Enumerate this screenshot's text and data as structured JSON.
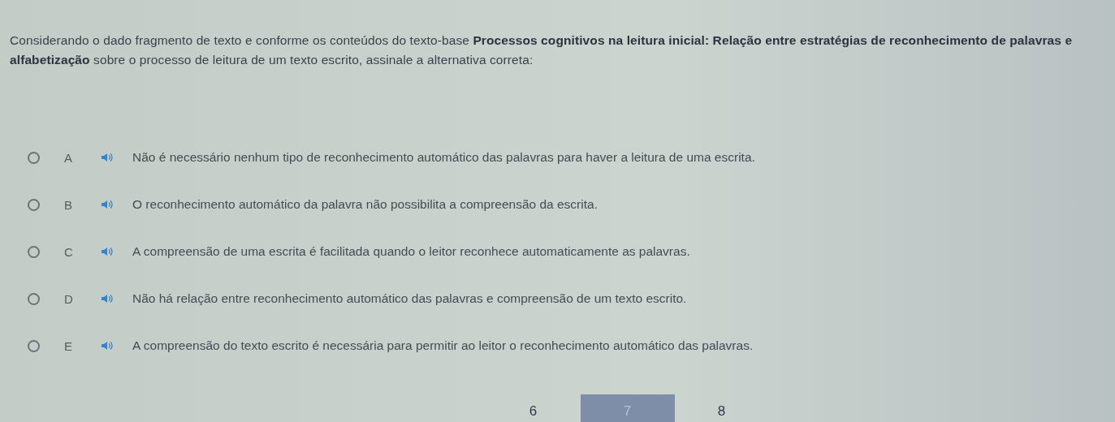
{
  "question": "Considerando o dado fragmento de texto e conforme os conteúdos do texto-base **Processos cognitivos na leitura inicial: Relação entre estratégias de reconhecimento de palavras e alfabetização** sobre o processo de leitura de um texto escrito, assinale a alternativa correta:",
  "options": [
    {
      "letter": "A",
      "text": "Não é necessário nenhum tipo de reconhecimento automático das palavras para haver a leitura de uma escrita.",
      "selected": false
    },
    {
      "letter": "B",
      "text": "O reconhecimento automático da palavra não possibilita a compreensão da escrita.",
      "selected": false
    },
    {
      "letter": "C",
      "text": "A compreensão de uma escrita é facilitada quando o leitor reconhece automaticamente as palavras.",
      "selected": false
    },
    {
      "letter": "D",
      "text": "Não há relação entre reconhecimento automático das palavras e compreensão de um texto escrito.",
      "selected": false
    },
    {
      "letter": "E",
      "text": "A compreensão do texto escrito é necessária para permitir ao leitor o reconhecimento automático das palavras.",
      "selected": false
    }
  ],
  "pages": [
    {
      "label": "6",
      "selected": false
    },
    {
      "label": "7",
      "selected": true
    },
    {
      "label": "8",
      "selected": false
    }
  ]
}
